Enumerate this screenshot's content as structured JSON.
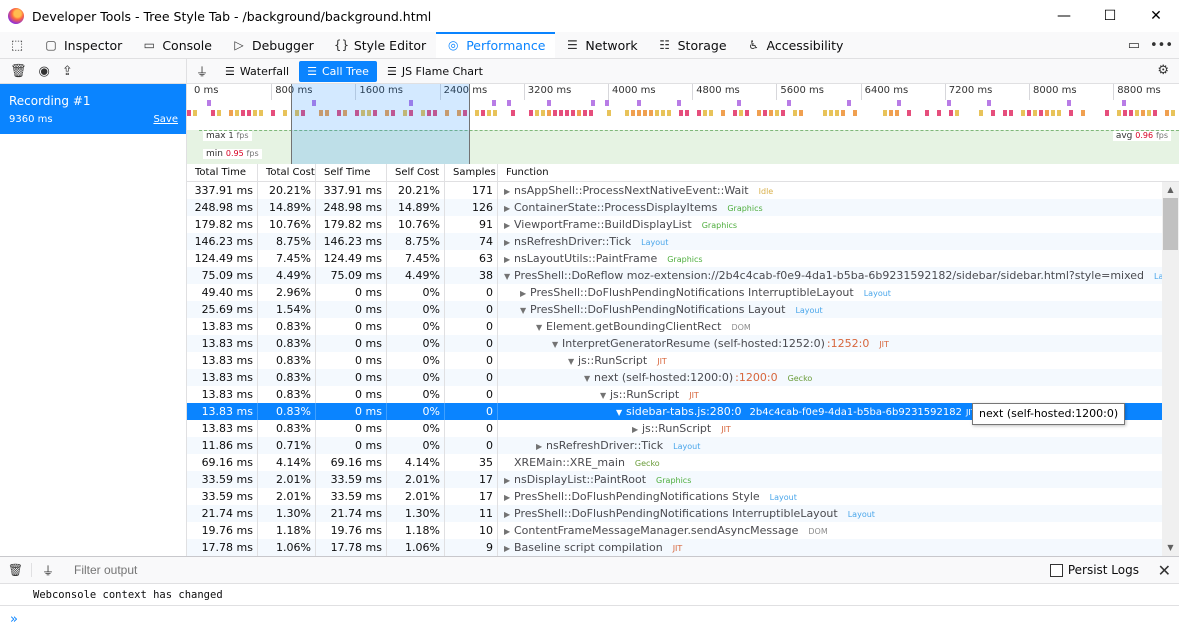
{
  "window": {
    "title": "Developer Tools - Tree Style Tab - /background/background.html",
    "min_glyph": "—",
    "max_glyph": "☐",
    "close_glyph": "✕"
  },
  "toolbox": {
    "picker_glyph": "⬚",
    "tabs": [
      {
        "label": "Inspector",
        "icon": "▢"
      },
      {
        "label": "Console",
        "icon": "▭"
      },
      {
        "label": "Debugger",
        "icon": "▷"
      },
      {
        "label": "Style Editor",
        "icon": "{}"
      },
      {
        "label": "Performance",
        "icon": "◎"
      },
      {
        "label": "Network",
        "icon": "☰"
      },
      {
        "label": "Storage",
        "icon": "☷"
      },
      {
        "label": "Accessibility",
        "icon": "♿"
      }
    ],
    "dock_glyph": "▭",
    "more_glyph": "•••"
  },
  "sidebar": {
    "trash_glyph": "🗑",
    "record_glyph": "◉",
    "import_glyph": "⇪",
    "recording": {
      "name": "Recording #1",
      "duration": "9360 ms",
      "save": "Save"
    }
  },
  "perf_toolbar": {
    "filter_glyph": "⏚",
    "views": [
      {
        "label": "Waterfall",
        "icon": "☰",
        "active": false
      },
      {
        "label": "Call Tree",
        "icon": "☰",
        "active": true
      },
      {
        "label": "JS Flame Chart",
        "icon": "☰",
        "active": false
      }
    ],
    "gear_glyph": "⚙"
  },
  "overview": {
    "ticks": [
      "0 ms",
      "800 ms",
      "1600 ms",
      "2400 ms",
      "3200 ms",
      "4000 ms",
      "4800 ms",
      "5600 ms",
      "6400 ms",
      "7200 ms",
      "8000 ms",
      "8800 ms"
    ],
    "fps": {
      "max_label": "max",
      "max_value": "1",
      "min_label": "min",
      "min_value": "0.95",
      "avg_label": "avg",
      "avg_value": "0.96",
      "unit": "fps"
    },
    "marker_colors": {
      "purple": "#b87ce6",
      "pink": "#e64e7c",
      "yellow": "#e8c35a",
      "orange": "#f0a050"
    }
  },
  "calltree": {
    "headers": [
      "Total Time",
      "Total Cost",
      "Self Time",
      "Self Cost",
      "Samples",
      "Function"
    ],
    "category_colors": {
      "Idle": "#d9b04a",
      "Graphics": "#4fae3e",
      "Layout": "#4aa6ea",
      "DOM": "#8c8c8c",
      "JIT": "#d7663c",
      "Gecko": "#6a9c3a"
    },
    "rows": [
      {
        "total": "337.91 ms",
        "tcost": "20.21%",
        "self": "337.91 ms",
        "scost": "20.21%",
        "samples": "171",
        "depth": 0,
        "arrow": "▶",
        "name": "nsAppShell::ProcessNextNativeEvent::Wait",
        "loc": "",
        "cat": "Idle"
      },
      {
        "total": "248.98 ms",
        "tcost": "14.89%",
        "self": "248.98 ms",
        "scost": "14.89%",
        "samples": "126",
        "depth": 0,
        "arrow": "▶",
        "name": "ContainerState::ProcessDisplayItems",
        "loc": "",
        "cat": "Graphics"
      },
      {
        "total": "179.82 ms",
        "tcost": "10.76%",
        "self": "179.82 ms",
        "scost": "10.76%",
        "samples": "91",
        "depth": 0,
        "arrow": "▶",
        "name": "ViewportFrame::BuildDisplayList",
        "loc": "",
        "cat": "Graphics"
      },
      {
        "total": "146.23 ms",
        "tcost": "8.75%",
        "self": "146.23 ms",
        "scost": "8.75%",
        "samples": "74",
        "depth": 0,
        "arrow": "▶",
        "name": "nsRefreshDriver::Tick",
        "loc": "",
        "cat": "Layout"
      },
      {
        "total": "124.49 ms",
        "tcost": "7.45%",
        "self": "124.49 ms",
        "scost": "7.45%",
        "samples": "63",
        "depth": 0,
        "arrow": "▶",
        "name": "nsLayoutUtils::PaintFrame",
        "loc": "",
        "cat": "Graphics"
      },
      {
        "total": "75.09 ms",
        "tcost": "4.49%",
        "self": "75.09 ms",
        "scost": "4.49%",
        "samples": "38",
        "depth": 0,
        "arrow": "▼",
        "name": "PresShell::DoReflow moz-extension://2b4c4cab-f0e9-4da1-b5ba-6b9231592182/sidebar/sidebar.html?style=mixed",
        "loc": "",
        "cat": "Layout"
      },
      {
        "total": "49.40 ms",
        "tcost": "2.96%",
        "self": "0 ms",
        "scost": "0%",
        "samples": "0",
        "depth": 1,
        "arrow": "▶",
        "name": "PresShell::DoFlushPendingNotifications InterruptibleLayout",
        "loc": "",
        "cat": "Layout"
      },
      {
        "total": "25.69 ms",
        "tcost": "1.54%",
        "self": "0 ms",
        "scost": "0%",
        "samples": "0",
        "depth": 1,
        "arrow": "▼",
        "name": "PresShell::DoFlushPendingNotifications Layout",
        "loc": "",
        "cat": "Layout"
      },
      {
        "total": "13.83 ms",
        "tcost": "0.83%",
        "self": "0 ms",
        "scost": "0%",
        "samples": "0",
        "depth": 2,
        "arrow": "▼",
        "name": "Element.getBoundingClientRect",
        "loc": "",
        "cat": "DOM"
      },
      {
        "total": "13.83 ms",
        "tcost": "0.83%",
        "self": "0 ms",
        "scost": "0%",
        "samples": "0",
        "depth": 3,
        "arrow": "▼",
        "name": "InterpretGeneratorResume (self-hosted:1252:0)",
        "loc": ":1252:0",
        "cat": "JIT"
      },
      {
        "total": "13.83 ms",
        "tcost": "0.83%",
        "self": "0 ms",
        "scost": "0%",
        "samples": "0",
        "depth": 4,
        "arrow": "▼",
        "name": "js::RunScript",
        "loc": "",
        "cat": "JIT"
      },
      {
        "total": "13.83 ms",
        "tcost": "0.83%",
        "self": "0 ms",
        "scost": "0%",
        "samples": "0",
        "depth": 5,
        "arrow": "▼",
        "name": "next (self-hosted:1200:0)",
        "loc": ":1200:0",
        "cat": "Gecko"
      },
      {
        "total": "13.83 ms",
        "tcost": "0.83%",
        "self": "0 ms",
        "scost": "0%",
        "samples": "0",
        "depth": 6,
        "arrow": "▼",
        "name": "js::RunScript",
        "loc": "",
        "cat": "JIT"
      },
      {
        "total": "13.83 ms",
        "tcost": "0.83%",
        "self": "0 ms",
        "scost": "0%",
        "samples": "0",
        "depth": 7,
        "arrow": "▼",
        "name": "sidebar-tabs.js:280:0",
        "loc": "",
        "cat": "JIT",
        "extra": "2b4c4cab-f0e9-4da1-b5ba-6b9231592182",
        "selected": true
      },
      {
        "total": "13.83 ms",
        "tcost": "0.83%",
        "self": "0 ms",
        "scost": "0%",
        "samples": "0",
        "depth": 8,
        "arrow": "▶",
        "name": "js::RunScript",
        "loc": "",
        "cat": "JIT"
      },
      {
        "total": "11.86 ms",
        "tcost": "0.71%",
        "self": "0 ms",
        "scost": "0%",
        "samples": "0",
        "depth": 2,
        "arrow": "▶",
        "name": "nsRefreshDriver::Tick",
        "loc": "",
        "cat": "Layout"
      },
      {
        "total": "69.16 ms",
        "tcost": "4.14%",
        "self": "69.16 ms",
        "scost": "4.14%",
        "samples": "35",
        "depth": 0,
        "arrow": "",
        "name": "XREMain::XRE_main",
        "loc": "",
        "cat": "Gecko"
      },
      {
        "total": "33.59 ms",
        "tcost": "2.01%",
        "self": "33.59 ms",
        "scost": "2.01%",
        "samples": "17",
        "depth": 0,
        "arrow": "▶",
        "name": "nsDisplayList::PaintRoot",
        "loc": "",
        "cat": "Graphics"
      },
      {
        "total": "33.59 ms",
        "tcost": "2.01%",
        "self": "33.59 ms",
        "scost": "2.01%",
        "samples": "17",
        "depth": 0,
        "arrow": "▶",
        "name": "PresShell::DoFlushPendingNotifications Style",
        "loc": "",
        "cat": "Layout"
      },
      {
        "total": "21.74 ms",
        "tcost": "1.30%",
        "self": "21.74 ms",
        "scost": "1.30%",
        "samples": "11",
        "depth": 0,
        "arrow": "▶",
        "name": "PresShell::DoFlushPendingNotifications InterruptibleLayout",
        "loc": "",
        "cat": "Layout"
      },
      {
        "total": "19.76 ms",
        "tcost": "1.18%",
        "self": "19.76 ms",
        "scost": "1.18%",
        "samples": "10",
        "depth": 0,
        "arrow": "▶",
        "name": "ContentFrameMessageManager.sendAsyncMessage",
        "loc": "",
        "cat": "DOM"
      },
      {
        "total": "17.78 ms",
        "tcost": "1.06%",
        "self": "17.78 ms",
        "scost": "1.06%",
        "samples": "9",
        "depth": 0,
        "arrow": "▶",
        "name": "Baseline script compilation",
        "loc": "",
        "cat": "JIT"
      }
    ],
    "tooltip": "next (self-hosted:1200:0)",
    "scroll_up_glyph": "▲",
    "scroll_down_glyph": "▼"
  },
  "console": {
    "trash_glyph": "🗑",
    "filter_glyph": "⏚",
    "filter_placeholder": "Filter output",
    "persist_logs": "Persist Logs",
    "close_glyph": "✕",
    "message": "Webconsole context has changed",
    "prompt_glyph": "»"
  }
}
